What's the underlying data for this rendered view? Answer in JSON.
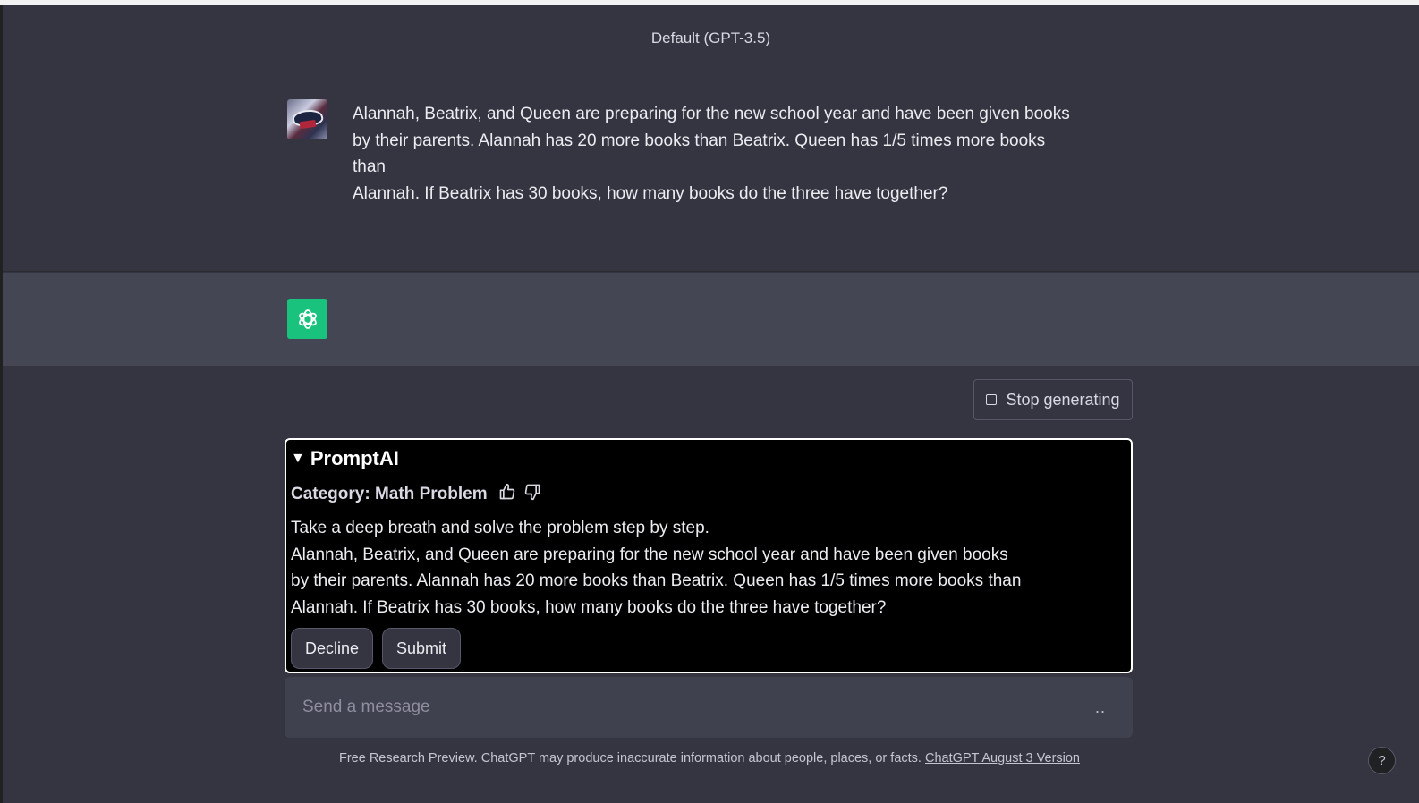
{
  "header": {
    "model_label": "Default (GPT-3.5)"
  },
  "user_message": {
    "lines": [
      "Alannah, Beatrix, and Queen are preparing for the new school year and have been given books",
      "by their parents. Alannah has 20 more books than Beatrix. Queen has 1/5 times more books than",
      "Alannah. If Beatrix has 30 books, how many books do the three have together?"
    ]
  },
  "stop_button": {
    "label": "Stop generating"
  },
  "promptai": {
    "title": "PromptAI",
    "category": "Category: Math Problem",
    "body_lines": [
      "Take a deep breath and solve the problem step by step.",
      "Alannah, Beatrix, and Queen are preparing for the new school year and have been given books",
      "by their parents. Alannah has 20 more books than Beatrix. Queen has 1/5 times more books than",
      "Alannah. If Beatrix has 30 books, how many books do the three have together?"
    ],
    "decline_label": "Decline",
    "submit_label": "Submit"
  },
  "composer": {
    "placeholder": "Send a message",
    "dots": ".."
  },
  "footer": {
    "text": "Free Research Preview. ChatGPT may produce inaccurate information about people, places, or facts. ",
    "link_text": "ChatGPT August 3 Version"
  },
  "help": {
    "label": "?"
  }
}
